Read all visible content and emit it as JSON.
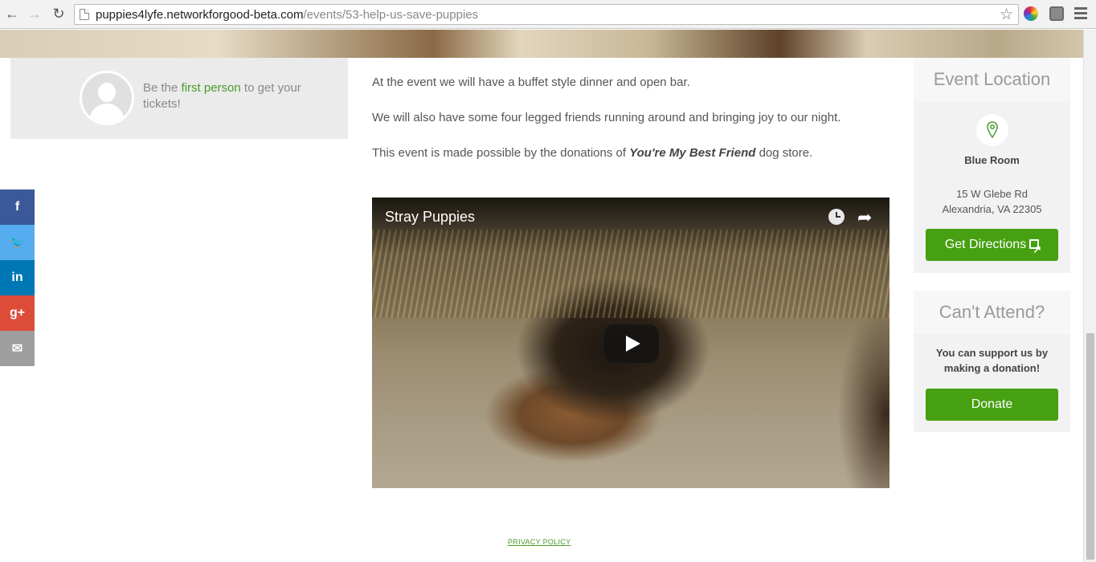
{
  "browser": {
    "url_host": "puppies4lyfe.networkforgood-beta.com",
    "url_path": "/events/53-help-us-save-puppies"
  },
  "attendees": {
    "prefix": "Be the ",
    "link": "first person",
    "suffix": " to get your tickets!"
  },
  "social": {
    "facebook": "f",
    "twitter": "🐦",
    "linkedin": "in",
    "googleplus": "g+",
    "email": "✉"
  },
  "description": {
    "p1": "At the event we will have a buffet style dinner and open bar.",
    "p2": "We will also have some four legged friends running around and bringing joy to our night.",
    "p3_before": "This event is made possible by the donations of ",
    "p3_store": "You're My Best Friend",
    "p3_after": " dog store."
  },
  "video": {
    "title": "Stray Puppies"
  },
  "location_card": {
    "title": "Event Location",
    "venue": "Blue Room",
    "address_line1": "15 W Glebe Rd",
    "address_line2": "Alexandria, VA 22305",
    "button": "Get Directions"
  },
  "attend_card": {
    "title": "Can't Attend?",
    "message": "You can support us by making a donation!",
    "button": "Donate"
  },
  "footer": {
    "privacy": "PRIVACY POLICY"
  },
  "colors": {
    "accent_green": "#46a012",
    "facebook": "#3b5998",
    "twitter": "#55acee",
    "linkedin": "#0077b5",
    "googleplus": "#dd4b39",
    "email": "#9e9e9e"
  }
}
